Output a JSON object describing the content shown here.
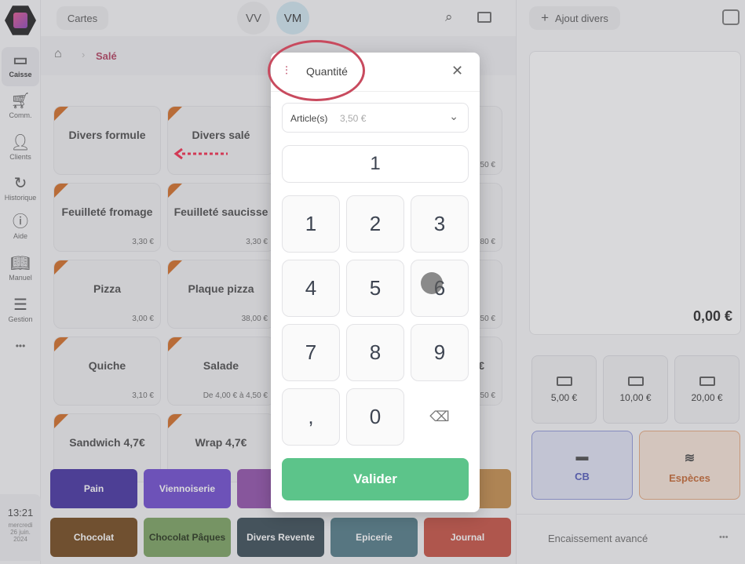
{
  "sidebar": {
    "items": [
      {
        "label": "Caisse",
        "icon": "register-icon"
      },
      {
        "label": "Comm.",
        "icon": "cart-icon"
      },
      {
        "label": "Clients",
        "icon": "user-icon"
      },
      {
        "label": "Historique",
        "icon": "history-icon"
      },
      {
        "label": "Aide",
        "icon": "help-icon"
      },
      {
        "label": "Manuel",
        "icon": "book-icon"
      },
      {
        "label": "Gestion",
        "icon": "sliders-icon"
      }
    ],
    "more": "•••",
    "time": "13:21",
    "day": "mercredi",
    "date": "26 juin.",
    "year": "2024"
  },
  "topbar": {
    "cartes": "Cartes",
    "users": [
      "VV",
      "VM"
    ]
  },
  "breadcrumb": {
    "current": "Salé"
  },
  "products": [
    {
      "name": "Divers formule",
      "price": ""
    },
    {
      "name": "Divers salé",
      "price": ""
    },
    {
      "name": "",
      "price": ""
    },
    {
      "name": "",
      "price": ",50 €"
    },
    {
      "name": "Feuilleté fromage",
      "price": "3,30 €"
    },
    {
      "name": "Feuilleté saucisse",
      "price": "3,30 €"
    },
    {
      "name": "",
      "price": ""
    },
    {
      "name": "",
      "price": ",80 €"
    },
    {
      "name": "Pizza",
      "price": "3,00 €"
    },
    {
      "name": "Plaque pizza",
      "price": "38,00 €"
    },
    {
      "name": "",
      "price": ""
    },
    {
      "name": "",
      "price": ",50 €"
    },
    {
      "name": "Quiche",
      "price": "3,10 €"
    },
    {
      "name": "Salade",
      "price": "De 4,00 € à 4,50 €"
    },
    {
      "name": "",
      "price": ""
    },
    {
      "name": "5€",
      "price": ",50 €"
    },
    {
      "name": "Sandwich 4,7€",
      "price": ""
    },
    {
      "name": "Wrap 4,7€",
      "price": ""
    }
  ],
  "categories": [
    {
      "label": "Pain",
      "color": "#3d2a9e"
    },
    {
      "label": "Viennoiserie",
      "color": "#6a45cf"
    },
    {
      "label": "Pât",
      "color": "#8e4aa8"
    },
    {
      "label": "",
      "color": "#5a5a5a"
    },
    {
      "label": "n",
      "color": "#c48a45"
    },
    {
      "label": "Chocolat",
      "color": "#6e4212"
    },
    {
      "label": "Chocolat Pâques",
      "color": "#76a05a",
      "text": "#1b2a10"
    },
    {
      "label": "Divers Revente",
      "color": "#324650"
    },
    {
      "label": "Epicerie",
      "color": "#4c7783"
    },
    {
      "label": "Journal",
      "color": "#c54a3b"
    }
  ],
  "right": {
    "ajout": "Ajout divers",
    "total": "0,00 €",
    "cash": [
      "5,00 €",
      "10,00 €",
      "20,00 €"
    ],
    "cb": "CB",
    "especes": "Espèces",
    "avance": "Encaissement avancé",
    "more": "•••"
  },
  "modal": {
    "title": "Quantité",
    "select_label": "Article(s)",
    "select_price": "3,50 €",
    "quantity": "1",
    "keys": [
      "1",
      "2",
      "3",
      "4",
      "5",
      "6",
      "7",
      "8",
      "9",
      ",",
      "0"
    ],
    "validate": "Valider",
    "accent": "#5cc48a"
  }
}
